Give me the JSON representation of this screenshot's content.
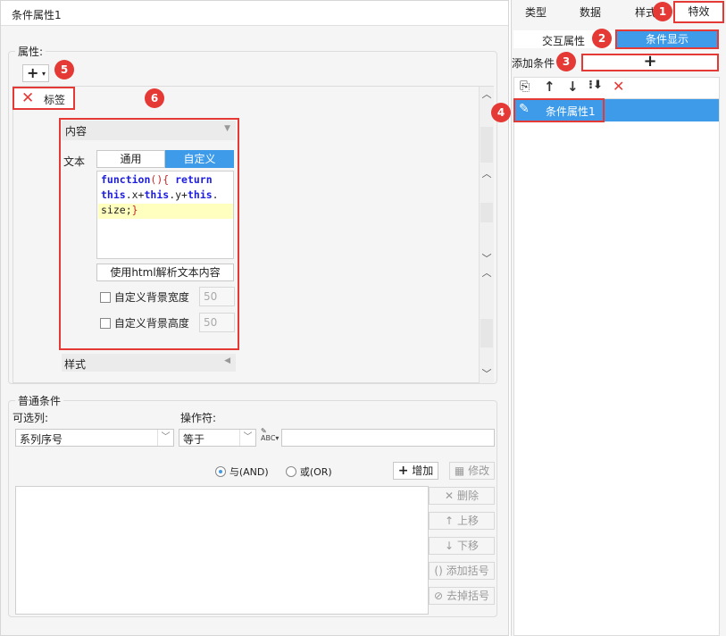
{
  "title": "条件属性1",
  "attributes": {
    "legend": "属性:",
    "tag_label": "标签",
    "content_header": "内容",
    "text_label": "文本",
    "tab_common": "通用",
    "tab_custom": "自定义",
    "code_lines": [
      "function(){ return",
      "this.x+this.y+this.",
      "size;}"
    ],
    "html_parse_button": "使用html解析文本内容",
    "custom_bg_width": "自定义背景宽度",
    "custom_bg_width_value": "50",
    "custom_bg_height": "自定义背景高度",
    "custom_bg_height_value": "50",
    "style_header": "样式"
  },
  "conditions": {
    "legend": "普通条件",
    "column_label": "可选列:",
    "operator_label": "操作符:",
    "column_value": "系列序号",
    "operator_value": "等于",
    "value_input": "",
    "and_label": "与(AND)",
    "or_label": "或(OR)",
    "add_button": "增加",
    "modify_button": "修改",
    "delete_button": "删除",
    "up_button": "上移",
    "down_button": "下移",
    "add_bracket_button": "添加括号",
    "remove_bracket_button": "去掉括号"
  },
  "right": {
    "tabs": [
      "类型",
      "数据",
      "样式",
      "特效"
    ],
    "sub_tab_interactive": "交互属性",
    "sub_tab_condition": "条件显示",
    "add_condition_label": "添加条件",
    "add_symbol": "+",
    "list_item": "条件属性1"
  },
  "badges": [
    "1",
    "2",
    "3",
    "4",
    "5",
    "6"
  ],
  "colors": {
    "accent": "#3d9be9",
    "highlight": "#e53935"
  }
}
